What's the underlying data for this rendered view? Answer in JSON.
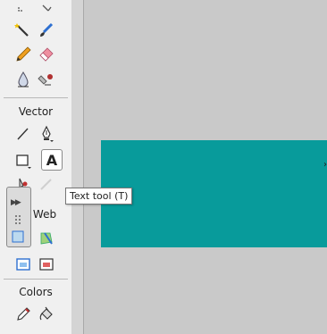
{
  "toolbar": {
    "sections": {
      "vector": "Vector",
      "web": "Web",
      "colors": "Colors"
    }
  },
  "tooltip": {
    "text": "Text tool (T)"
  },
  "canvas": {
    "shape_color": "#089b9b",
    "background": "#c9c9c9"
  },
  "icons": [
    "magic-wand-icon",
    "brush-icon",
    "pencil-icon",
    "eraser-icon",
    "blur-icon",
    "rubber-stamp-icon",
    "line-icon",
    "pen-icon",
    "rectangle-icon",
    "text-icon",
    "freeform-icon",
    "knife-icon",
    "expand-arrows-icon",
    "slice-icon",
    "hide-slices-icon",
    "show-slices-icon",
    "eyedropper-icon",
    "paint-bucket-icon"
  ]
}
